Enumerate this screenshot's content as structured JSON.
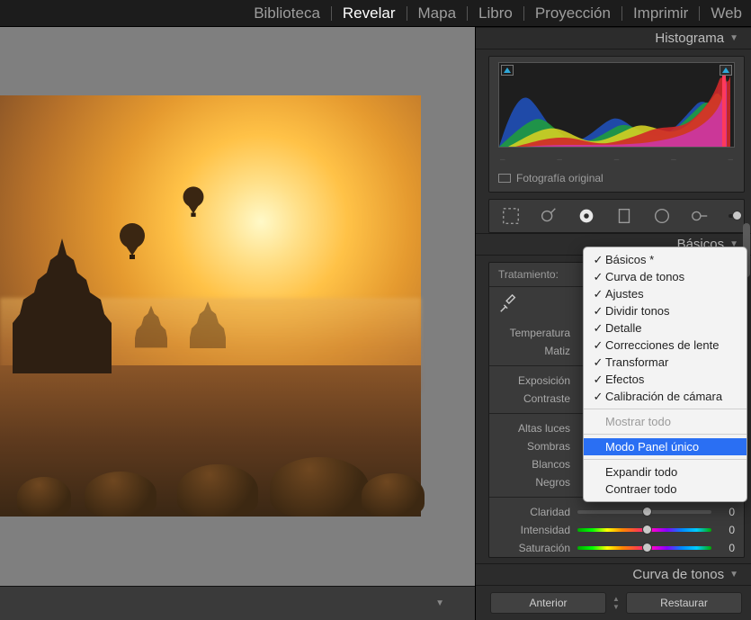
{
  "modules": {
    "items": [
      "Biblioteca",
      "Revelar",
      "Mapa",
      "Libro",
      "Proyección",
      "Imprimir",
      "Web"
    ],
    "active_index": 1
  },
  "right": {
    "histogram_title": "Histograma",
    "original_label": "Fotografía original",
    "basic_title": "Básicos",
    "treat_label": "Tratamiento:",
    "sliders": {
      "temperature": "Temperatura",
      "tint": "Matiz",
      "exposure": "Exposición",
      "contrast": "Contraste",
      "highlights": "Altas luces",
      "shadows": "Sombras",
      "whites": "Blancos",
      "blacks": "Negros",
      "clarity": "Claridad",
      "vibrance": "Intensidad",
      "saturation": "Saturación"
    },
    "values": {
      "clarity": "0",
      "vibrance": "0",
      "saturation": "0"
    },
    "tone_curve_title": "Curva de tonos",
    "btn_prev": "Anterior",
    "btn_reset": "Restaurar"
  },
  "context_menu": {
    "items": [
      {
        "label": "Básicos *",
        "checked": true
      },
      {
        "label": "Curva de tonos",
        "checked": true
      },
      {
        "label": "Ajustes",
        "checked": true
      },
      {
        "label": "Dividir tonos",
        "checked": true
      },
      {
        "label": "Detalle",
        "checked": true
      },
      {
        "label": "Correcciones de lente",
        "checked": true
      },
      {
        "label": "Transformar",
        "checked": true
      },
      {
        "label": "Efectos",
        "checked": true
      },
      {
        "label": "Calibración de cámara",
        "checked": true
      }
    ],
    "show_all": "Mostrar todo",
    "solo_mode": "Modo Panel único",
    "expand_all": "Expandir todo",
    "collapse_all": "Contraer todo"
  }
}
